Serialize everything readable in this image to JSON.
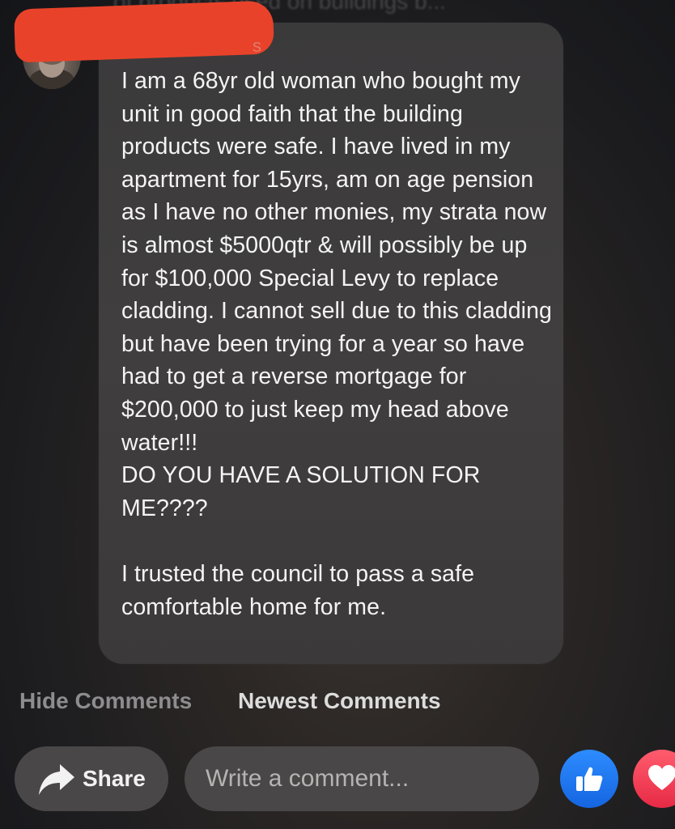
{
  "post": {
    "truncated_text": "of products used on buildings b..."
  },
  "comment": {
    "author_fragment": "s",
    "text": "I am a 68yr old woman who bought my unit in good faith that the building products were safe. I have lived in my apartment for 15yrs, am on age pension as I have no other monies, my strata now is almost $5000qtr & will possibly be up for $100,000 Special Levy to replace cladding. I cannot sell due to this cladding but have been trying for a year so have had to get a reverse mortgage for $200,000 to just keep my head above water!!!\nDO YOU HAVE A SOLUTION FOR ME????\n\nI trusted the council to pass a safe comfortable home for me."
  },
  "actions": {
    "hide_comments": "Hide Comments",
    "newest_comments": "Newest Comments"
  },
  "footer": {
    "share_label": "Share",
    "share_icon": "share-arrow-icon",
    "comment_placeholder": "Write a comment...",
    "like_icon": "thumbs-up-icon",
    "love_icon": "heart-icon"
  },
  "colors": {
    "redaction": "#e8432a",
    "like_blue": "#1877f2",
    "love_red": "#f02849"
  }
}
